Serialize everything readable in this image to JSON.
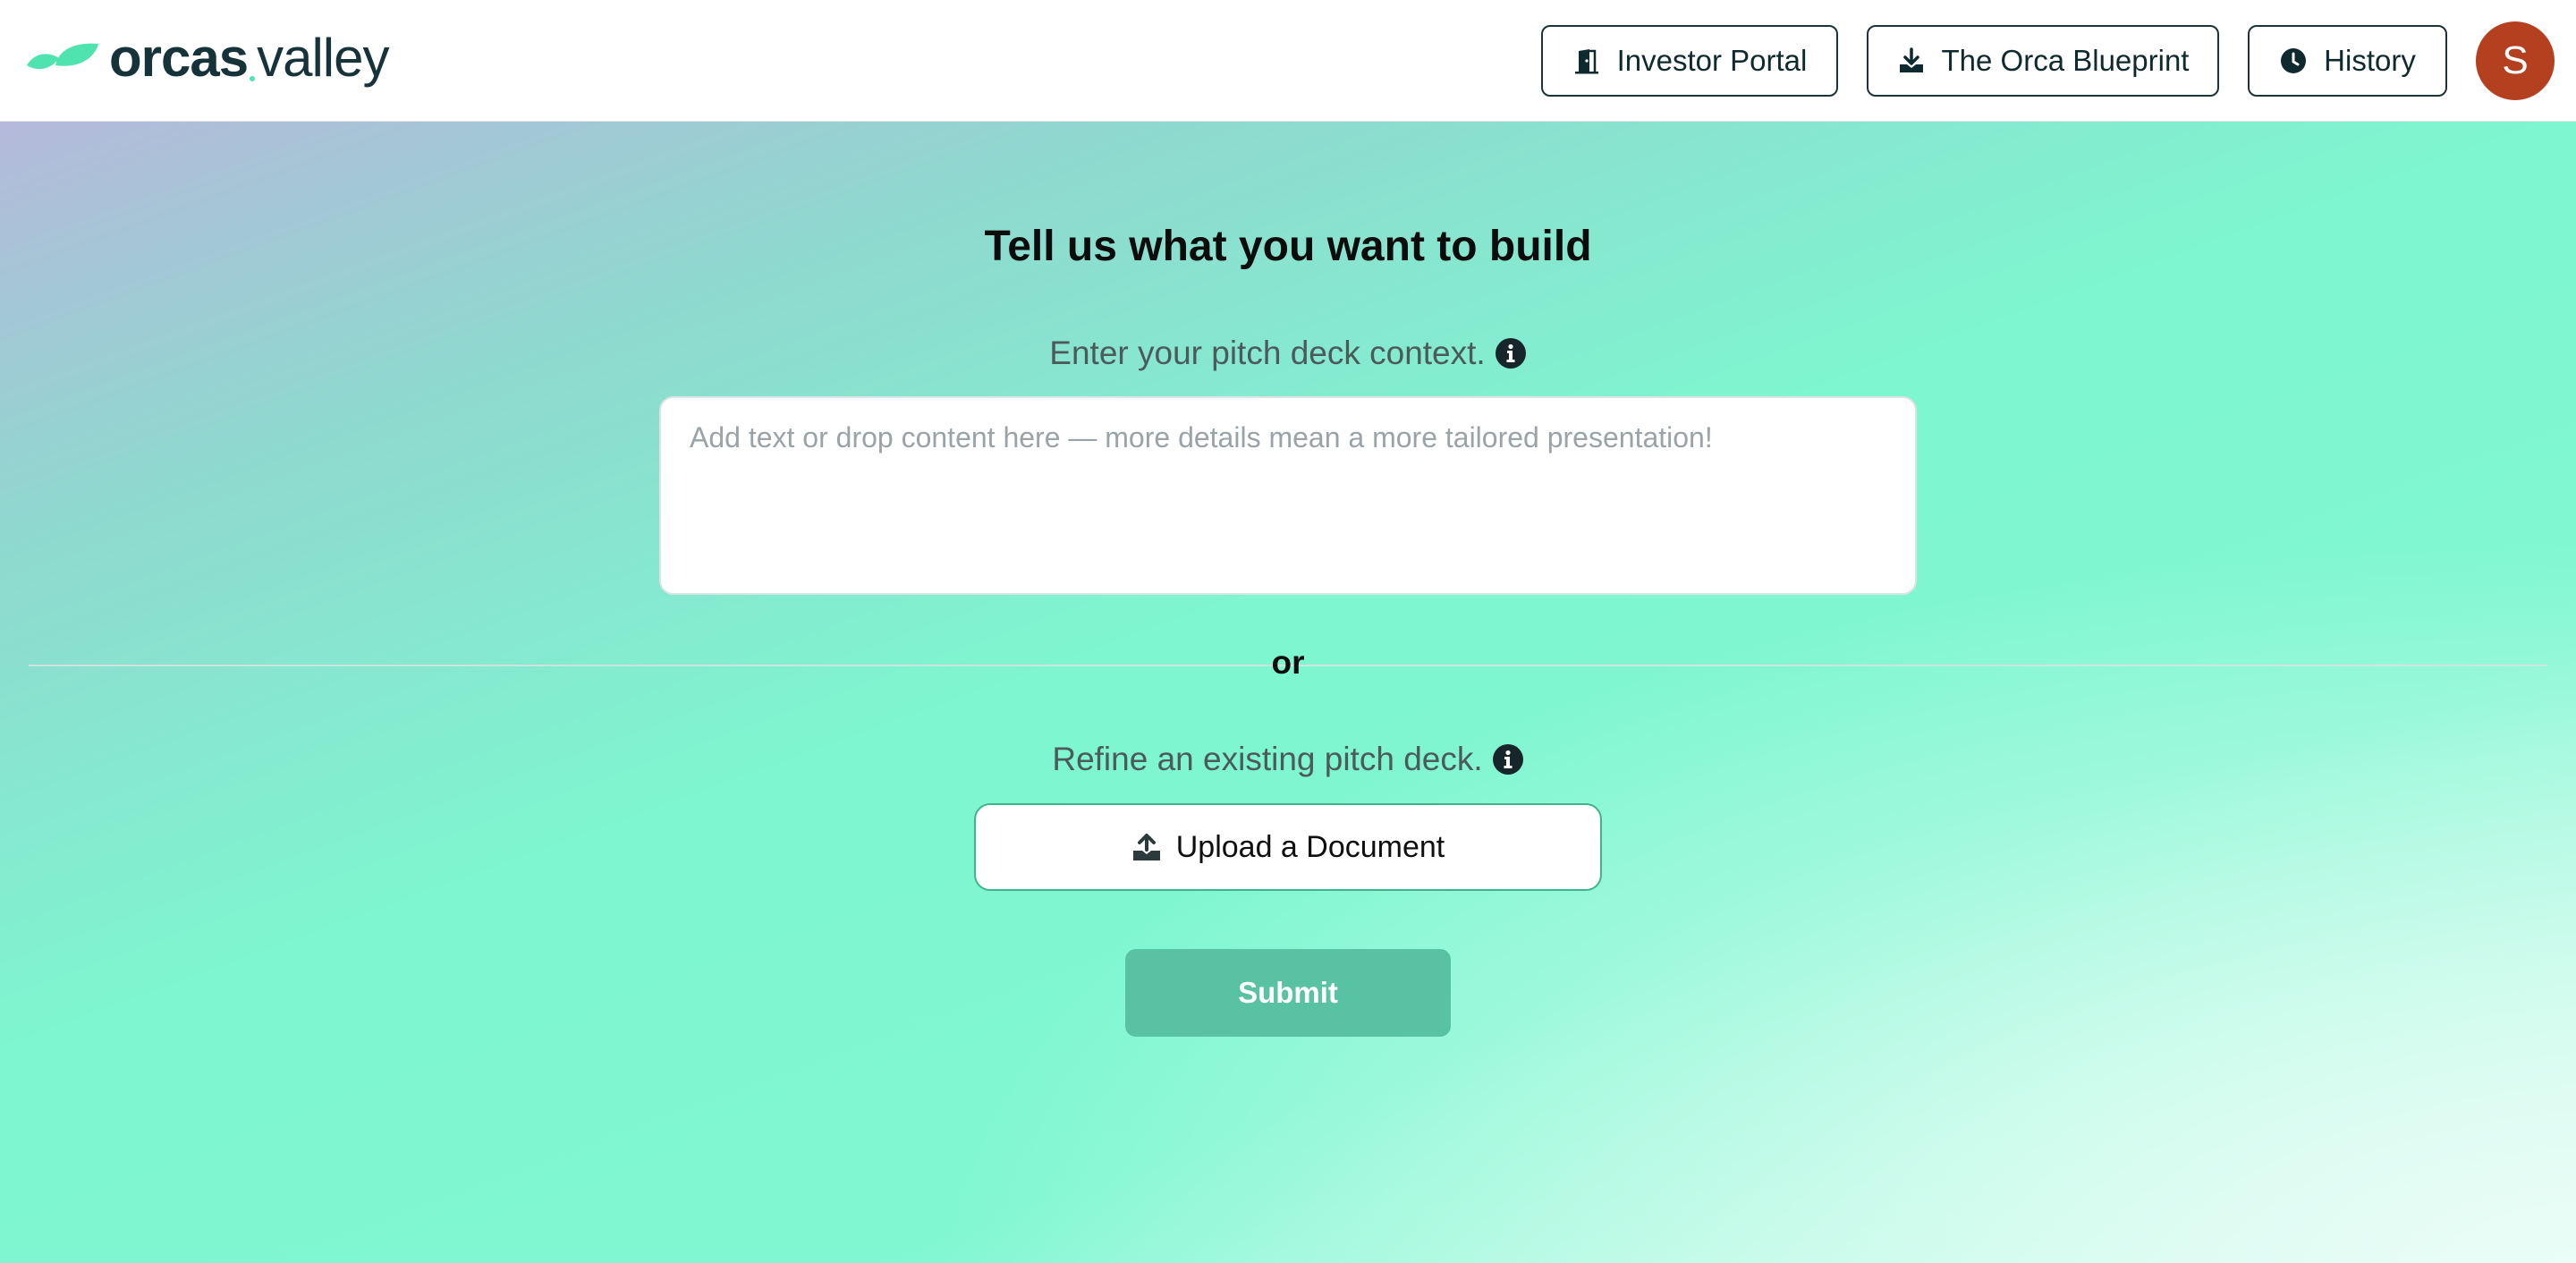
{
  "brand": {
    "name_part1": "orcas",
    "name_part2": "valley",
    "accent_color": "#4fe3b0"
  },
  "header": {
    "buttons": [
      {
        "label": "Investor Portal",
        "icon": "door-exit-icon"
      },
      {
        "label": "The Orca Blueprint",
        "icon": "download-icon"
      },
      {
        "label": "History",
        "icon": "clock-icon"
      }
    ],
    "avatar_initial": "S",
    "avatar_color": "#b5401f"
  },
  "main": {
    "title": "Tell us what you want to build",
    "context_label": "Enter your pitch deck context.",
    "context_placeholder": "Add text or drop content here — more details mean a more tailored presentation!",
    "context_value": "",
    "or_text": "or",
    "refine_label": "Refine an existing pitch deck.",
    "upload_label": "Upload a Document",
    "submit_label": "Submit",
    "submit_color": "#59c2a2"
  }
}
